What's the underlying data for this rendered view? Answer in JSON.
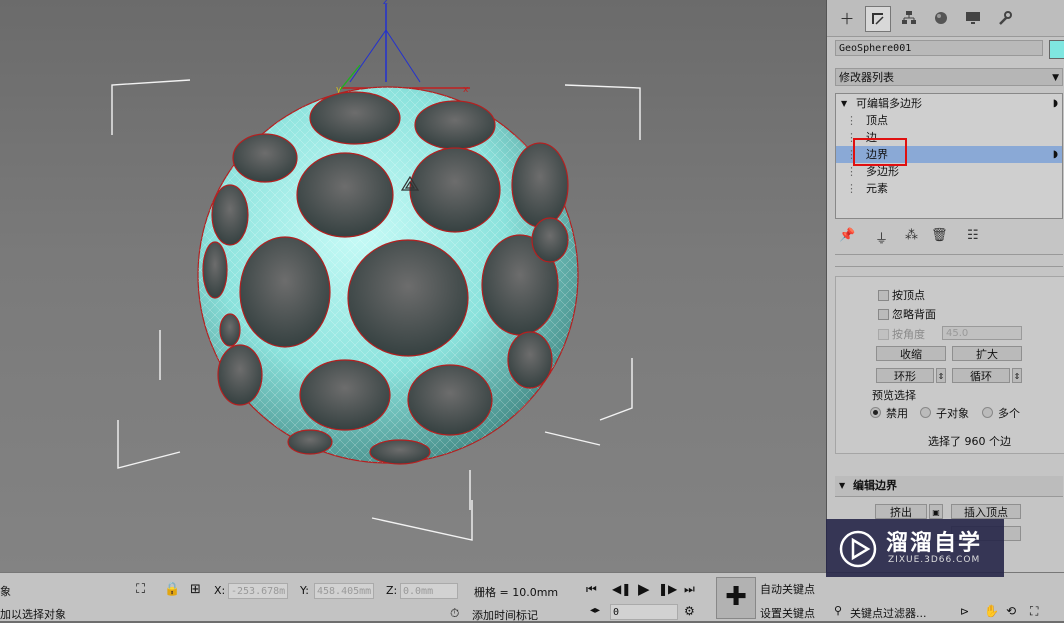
{
  "command_panel": {
    "tabs": [
      {
        "icon": "create-plus-icon"
      },
      {
        "icon": "modify-icon"
      },
      {
        "icon": "hierarchy-icon"
      },
      {
        "icon": "motion-icon"
      },
      {
        "icon": "display-icon"
      },
      {
        "icon": "utilities-wrench-icon"
      }
    ],
    "object_name": "GeoSphere001",
    "object_color": "#7fe6e0",
    "modifier_list_label": "修改器列表",
    "stack": {
      "root": "可编辑多边形",
      "items": [
        "顶点",
        "边",
        "边界",
        "多边形",
        "元素"
      ],
      "selected": "边界"
    },
    "selection": {
      "by_vertex": "按顶点",
      "ignore_backfacing": "忽略背面",
      "by_angle": "按角度",
      "angle_value": "45.0",
      "shrink": "收缩",
      "grow": "扩大",
      "ring": "环形",
      "loop": "循环",
      "preview_title": "预览选择",
      "preview_options": [
        "禁用",
        "子对象",
        "多个"
      ],
      "preview_selected": "禁用",
      "status": "选择了 960 个边"
    },
    "edit_borders": {
      "title": "编辑边界",
      "extrude": "挤出",
      "insert_vertex": "插入顶点"
    }
  },
  "status_bar": {
    "left_line1": "象",
    "left_line2": "加以选择对象",
    "x_label": "X:",
    "x_value": "-253.678m",
    "y_label": "Y:",
    "y_value": "458.405mm",
    "z_label": "Z:",
    "z_value": "0.0mm",
    "grid_label": "栅格 = 10.0mm",
    "add_time_tag": "添加时间标记",
    "frame_value": "0",
    "auto_key": "自动关键点",
    "set_key": "设置关键点",
    "key_filters": "关键点过滤器..."
  },
  "watermark": {
    "title": "溜溜自学",
    "url": "ZIXUE.3D66.COM"
  }
}
